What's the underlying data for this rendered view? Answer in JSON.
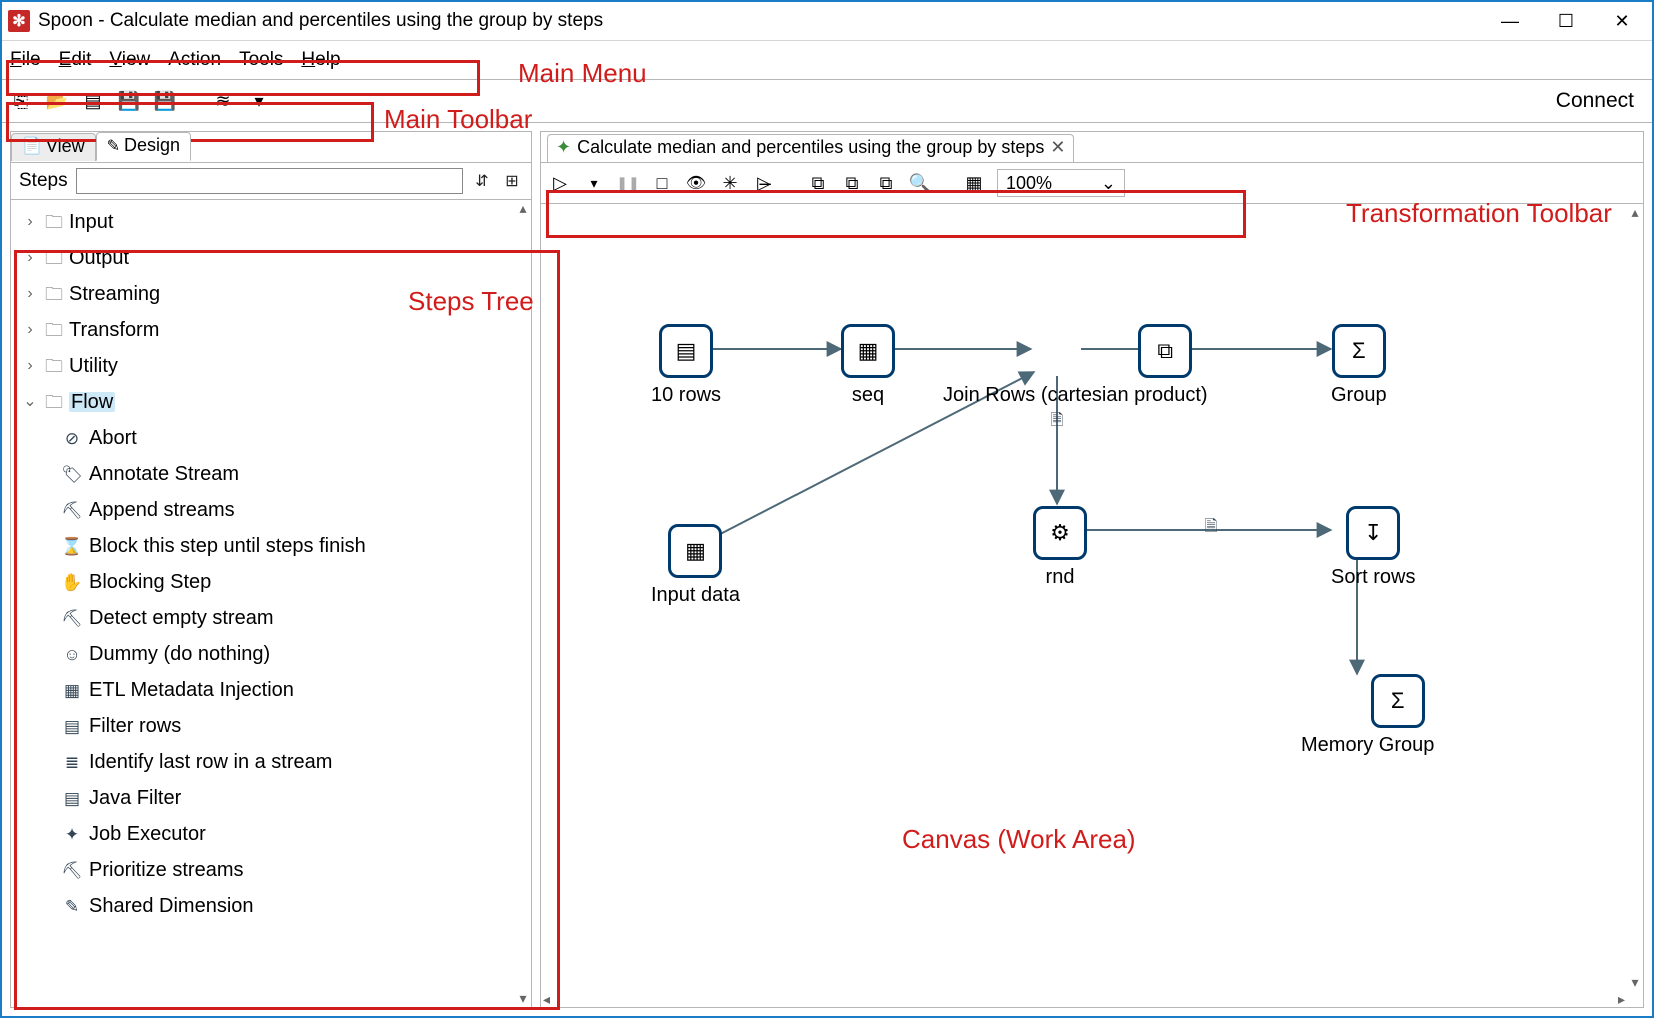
{
  "titlebar": {
    "app_name": "Spoon - Calculate median and percentiles using the group by steps",
    "logo_glyph": "✻",
    "min": "—",
    "max": "☐",
    "close": "✕"
  },
  "menu": {
    "file": "File",
    "edit": "Edit",
    "view": "View",
    "action": "Action",
    "tools": "Tools",
    "help": "Help"
  },
  "toolbar": {
    "new": "⎘",
    "open": "📂",
    "list": "▤",
    "save": "💾",
    "saveas": "💾",
    "layers": "≋",
    "layers_drop": "▾",
    "connect": "Connect"
  },
  "annotations": {
    "main_menu": "Main Menu",
    "main_toolbar": "Main Toolbar",
    "steps_tree": "Steps Tree",
    "trans_toolbar": "Transformation Toolbar",
    "canvas": "Canvas (Work Area)"
  },
  "side": {
    "view_tab": "View",
    "view_icon": "📄",
    "design_tab": "Design",
    "design_icon": "✎",
    "steps_label": "Steps",
    "search_value": "",
    "tree_btn1": "⇵",
    "tree_btn2": "⊞"
  },
  "folders": [
    {
      "label": "Input",
      "expanded": false
    },
    {
      "label": "Output",
      "expanded": false
    },
    {
      "label": "Streaming",
      "expanded": false
    },
    {
      "label": "Transform",
      "expanded": false
    },
    {
      "label": "Utility",
      "expanded": false
    },
    {
      "label": "Flow",
      "expanded": true,
      "selected": true
    }
  ],
  "flow_steps": [
    {
      "icon": "⊘",
      "label": "Abort"
    },
    {
      "icon": "🏷",
      "label": "Annotate Stream"
    },
    {
      "icon": "⛏",
      "label": "Append streams"
    },
    {
      "icon": "⌛",
      "label": "Block this step until steps finish"
    },
    {
      "icon": "✋",
      "label": "Blocking Step"
    },
    {
      "icon": "⛏",
      "label": "Detect empty stream"
    },
    {
      "icon": "☺",
      "label": "Dummy (do nothing)"
    },
    {
      "icon": "▦",
      "label": "ETL Metadata Injection"
    },
    {
      "icon": "▤",
      "label": "Filter rows"
    },
    {
      "icon": "≣",
      "label": "Identify last row in a stream"
    },
    {
      "icon": "▤",
      "label": "Java Filter"
    },
    {
      "icon": "✦",
      "label": "Job Executor"
    },
    {
      "icon": "⛏",
      "label": "Prioritize streams"
    },
    {
      "icon": "✎",
      "label": "Shared Dimension"
    }
  ],
  "editor_tab": {
    "icon": "✦",
    "label": "Calculate median and percentiles using the group by steps",
    "close": "✕"
  },
  "trans_toolbar": {
    "run": "▷",
    "run_drop": "▾",
    "pause": "❚❚",
    "stop": "□",
    "preview": "👁",
    "debug": "✳",
    "replay": "▷̶",
    "sql": "⧉",
    "explore": "⧉",
    "impact": "⧉",
    "magnify": "🔍",
    "grid": "▦",
    "zoom": "100%",
    "zoom_drop": "⌄"
  },
  "nodes": {
    "tenrows": {
      "label": "10 rows",
      "glyph": "▤"
    },
    "seq": {
      "label": "seq",
      "glyph": "▦"
    },
    "join": {
      "label": "Join Rows (cartesian product)",
      "glyph": "⧉"
    },
    "group": {
      "label": "Group",
      "glyph": "Σ"
    },
    "inputdata": {
      "label": "Input data",
      "glyph": "▦"
    },
    "rnd": {
      "label": "rnd",
      "glyph": "⚙"
    },
    "sort": {
      "label": "Sort rows",
      "glyph": "↧"
    },
    "memgroup": {
      "label": "Memory Group",
      "glyph": "Σ"
    }
  },
  "hop": {
    "glyph": "🗎"
  }
}
